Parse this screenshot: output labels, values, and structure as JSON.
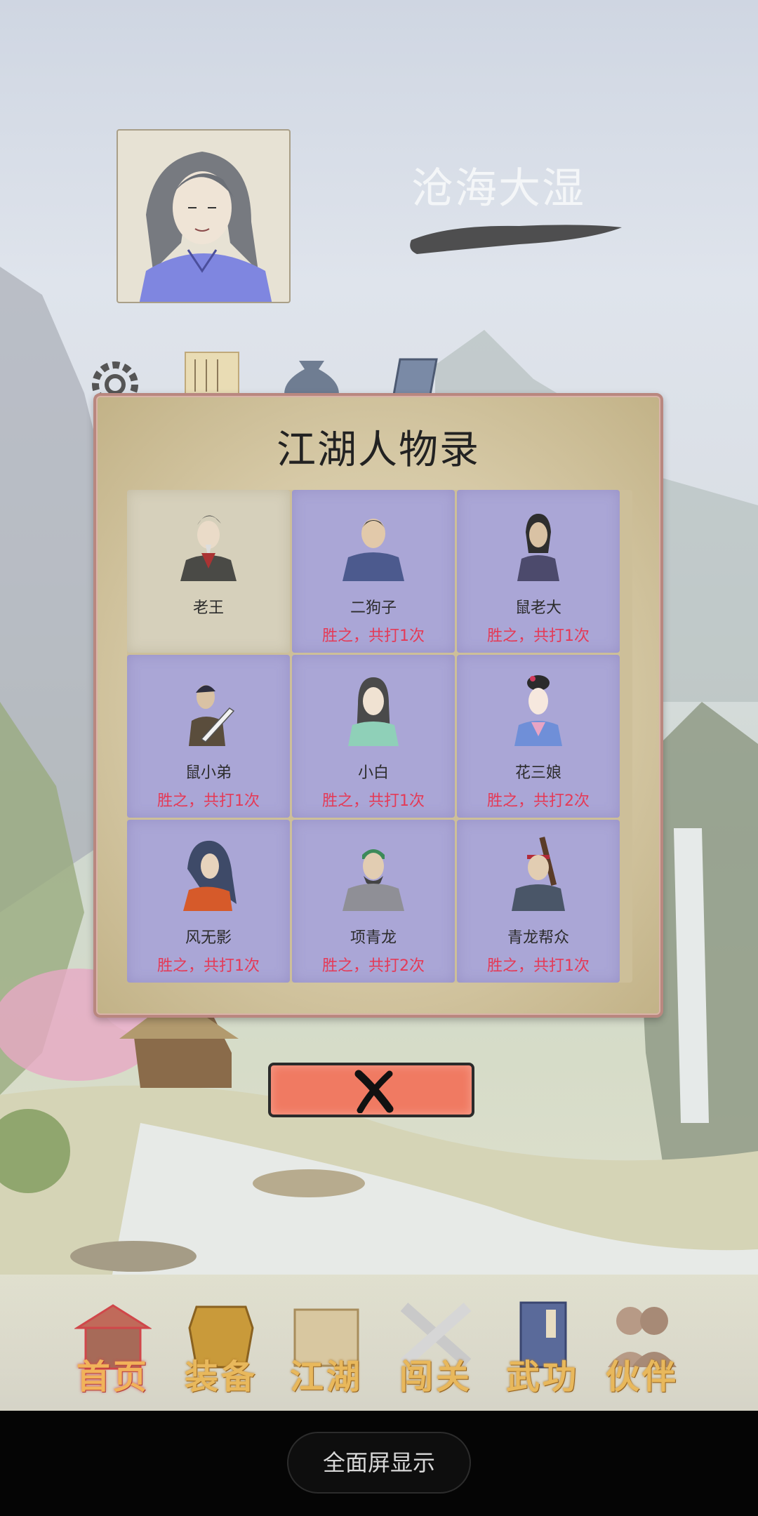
{
  "player": {
    "name": "沧海大湿"
  },
  "top_icons": [
    "gear-icon",
    "scroll-icon",
    "money-bag-icon",
    "book-icon"
  ],
  "dialog": {
    "title": "江湖人物录",
    "characters": [
      {
        "name": "老王",
        "record": ""
      },
      {
        "name": "二狗子",
        "record": "胜之，共打1次"
      },
      {
        "name": "鼠老大",
        "record": "胜之，共打1次"
      },
      {
        "name": "鼠小弟",
        "record": "胜之，共打1次"
      },
      {
        "name": "小白",
        "record": "胜之，共打1次"
      },
      {
        "name": "花三娘",
        "record": "胜之，共打2次"
      },
      {
        "name": "风无影",
        "record": "胜之，共打1次"
      },
      {
        "name": "项青龙",
        "record": "胜之，共打2次"
      },
      {
        "name": "青龙帮众",
        "record": "胜之，共打1次"
      }
    ],
    "close_icon": "close-x-icon"
  },
  "nav": [
    {
      "label": "首页",
      "icon": "house-icon"
    },
    {
      "label": "装备",
      "icon": "armor-icon"
    },
    {
      "label": "江湖",
      "icon": "map-scroll-icon"
    },
    {
      "label": "闯关",
      "icon": "crossed-swords-icon"
    },
    {
      "label": "武功",
      "icon": "martial-book-icon"
    },
    {
      "label": "伙伴",
      "icon": "partners-icon"
    }
  ],
  "system": {
    "fullscreen_label": "全面屏显示"
  },
  "colors": {
    "defeated_cell": "#aaa6d6",
    "record_text": "#e43a57",
    "close_button": "#f07a62",
    "nav_label": "#e8b85c"
  }
}
